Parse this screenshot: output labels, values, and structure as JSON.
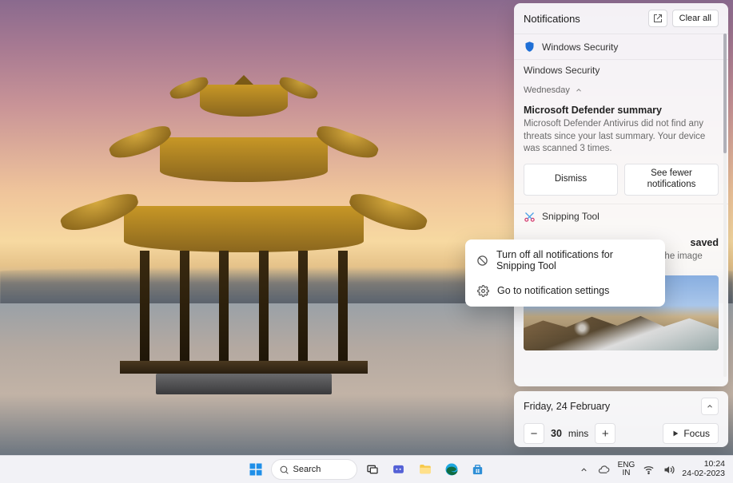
{
  "panel": {
    "title": "Notifications",
    "clear_all": "Clear all",
    "groups": {
      "security": {
        "app": "Windows Security",
        "subhead": "Windows Security",
        "day": "Wednesday",
        "item": {
          "title": "Microsoft Defender summary",
          "body": "Microsoft Defender Antivirus did not find any threats since your last summary. Your device was scanned 3 times.",
          "dismiss": "Dismiss",
          "fewer": "See fewer notifications"
        }
      },
      "snip": {
        "app": "Snipping Tool",
        "item_title_suffix": "saved",
        "item_body": "Select here to mark up and share the image"
      }
    }
  },
  "context_menu": {
    "turn_off": "Turn off all notifications for Snipping Tool",
    "settings": "Go to notification settings"
  },
  "calendar": {
    "date": "Friday, 24 February",
    "mins_value": "30",
    "mins_unit": "mins",
    "focus": "Focus"
  },
  "taskbar": {
    "search": "Search",
    "lang_top": "ENG",
    "lang_bottom": "IN",
    "time": "10:24",
    "date": "24-02-2023"
  }
}
